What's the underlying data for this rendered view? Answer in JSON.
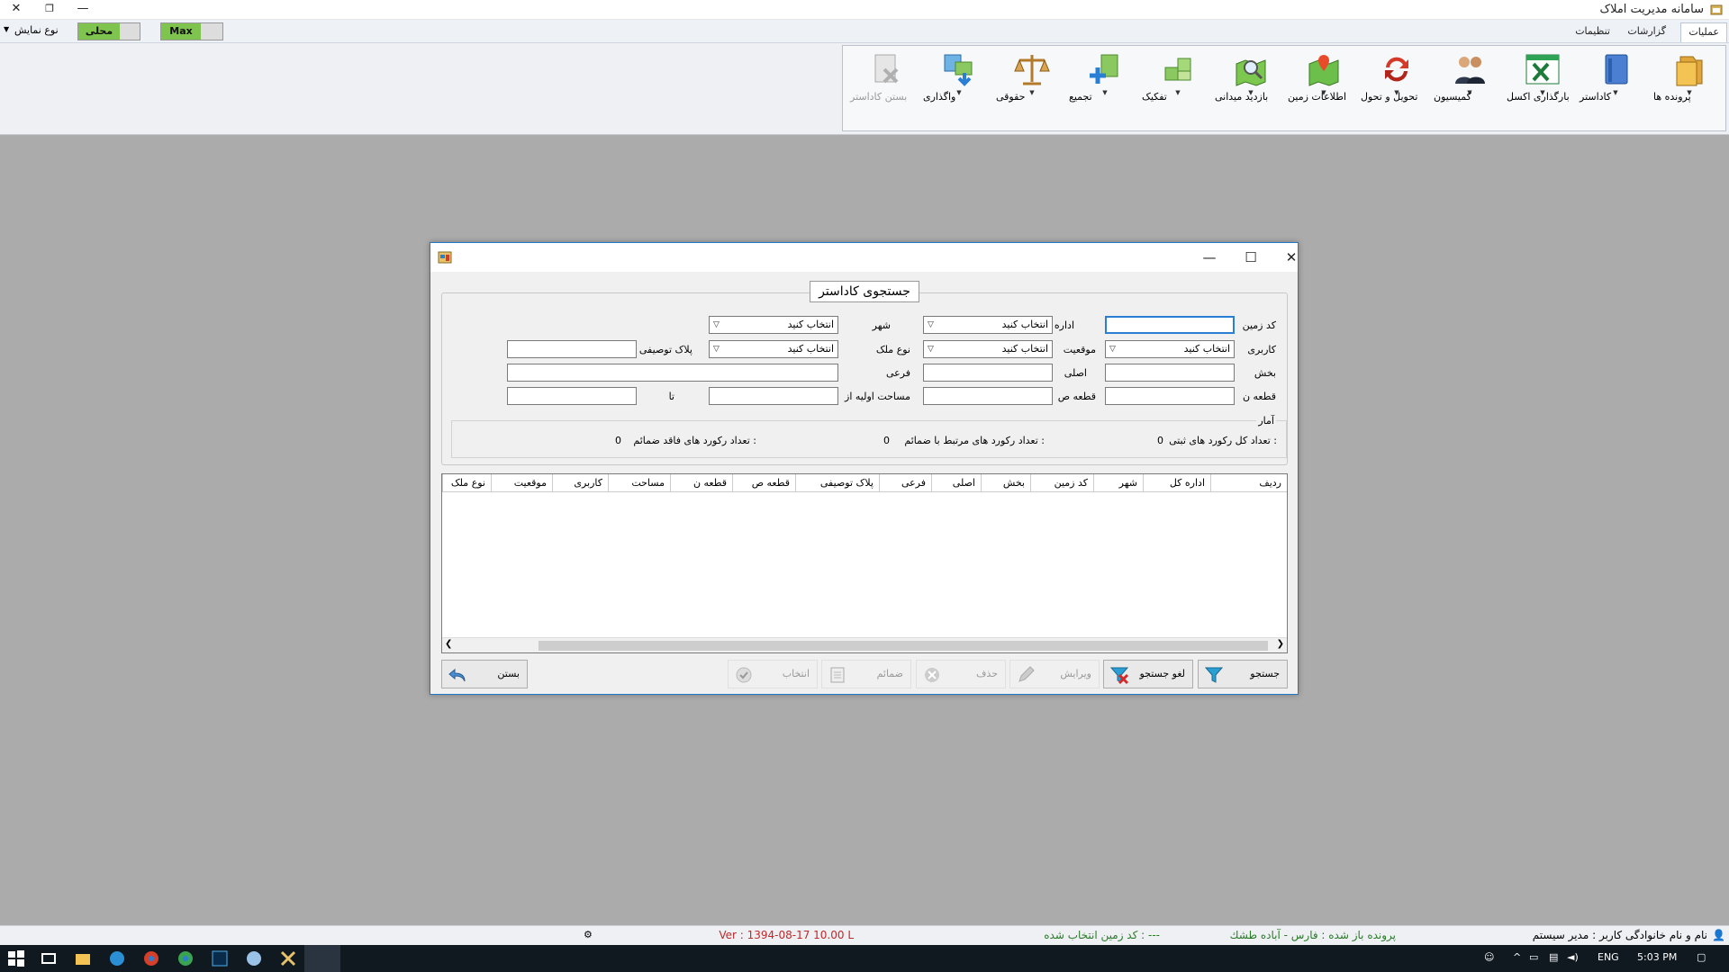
{
  "app": {
    "title": "سامانه مدیریت املاک",
    "controls": {
      "close": "✕",
      "restore": "❐",
      "minimize": "—"
    }
  },
  "menu": {
    "tabs": [
      {
        "label": "عملیات",
        "active": true
      },
      {
        "label": "گزارشات",
        "active": false
      },
      {
        "label": "تنظیمات",
        "active": false
      }
    ],
    "display_type": "نوع نمایش",
    "toggle_local": "محلی",
    "toggle_max": "Max",
    "accent_green": "#7fc44f"
  },
  "ribbon": {
    "buttons": [
      {
        "label": "پرونده ها",
        "icon": "folder-icon"
      },
      {
        "label": "کاداستر",
        "icon": "book-icon"
      },
      {
        "label": "بارگذاری اکسل",
        "icon": "excel-icon"
      },
      {
        "label": "کمیسیون",
        "icon": "users-icon"
      },
      {
        "label": "تحویل و تحول",
        "icon": "refresh-icon"
      },
      {
        "label": "اطلاعات زمین",
        "icon": "map-pin-icon"
      },
      {
        "label": "بازدید میدانی",
        "icon": "map-search-icon"
      },
      {
        "label": "تفکیک",
        "icon": "split-icon"
      },
      {
        "label": "تجمیع",
        "icon": "merge-icon"
      },
      {
        "label": "حقوقی",
        "icon": "scales-icon"
      },
      {
        "label": "واگذاری",
        "icon": "transfer-icon"
      },
      {
        "label": "بستن کاداستر",
        "icon": "close-document-icon",
        "disabled": true
      }
    ]
  },
  "dialog": {
    "group_title": "جستجوی کاداستر",
    "fields": {
      "land_code": "کد زمین",
      "general_office": "اداره کل",
      "city": "شهر",
      "usage": "کاربری",
      "position": "موقعیت",
      "property_type": "نوع ملک",
      "desc_plate": "پلاک توصیفی",
      "section": "بخش",
      "main": "اصلی",
      "sub": "فرعی",
      "piece_n": "قطعه ن",
      "piece_s": "قطعه ص",
      "initial_area_from": "مساحت اولیه از",
      "to": "تا"
    },
    "select_placeholder": "انتخاب کنید",
    "stats": {
      "title": "آمار",
      "total_label": "تعداد کل رکورد های ثبتی :",
      "total_value": "0",
      "linked_label": "تعداد رکورد های مرتبط با ضمائم :",
      "linked_value": "0",
      "nolink_label": "تعداد رکورد های فاقد ضمائم :",
      "nolink_value": "0"
    },
    "columns": [
      "ردیف",
      "اداره کل",
      "شهر",
      "کد زمین",
      "بخش",
      "اصلی",
      "فرعی",
      "پلاک توصیفی",
      "قطعه ص",
      "قطعه ن",
      "مساحت",
      "کاربری",
      "موقعیت",
      "نوع ملک"
    ],
    "buttons": {
      "search": "جستجو",
      "cancel_search": "لغو جستجو",
      "edit": "ویرایش",
      "delete": "حذف",
      "attachments": "ضمائم",
      "select": "انتخاب",
      "close": "بستن"
    }
  },
  "status": {
    "user": "نام و نام خانوادگی کاربر :  مدیر سیستم",
    "opened_file": "پرونده باز شده : فارس - آباده طشك",
    "selected_land": "کد زمین انتخاب شده : ---",
    "version": "Ver : 1394-08-17 10.00 L"
  },
  "taskbar": {
    "lang": "ENG",
    "time": "5:03 PM"
  }
}
